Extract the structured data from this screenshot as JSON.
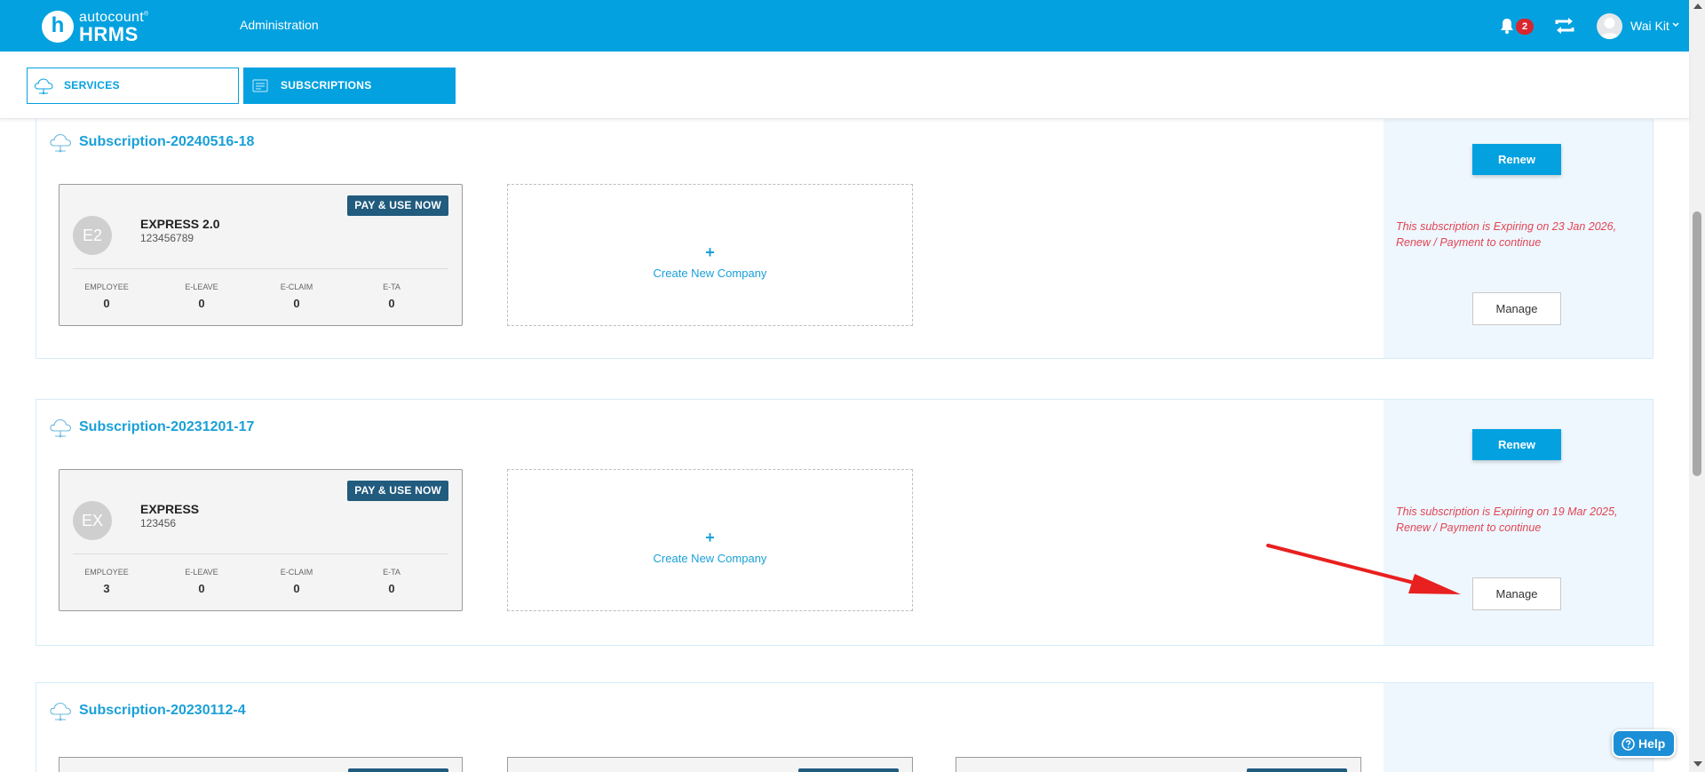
{
  "header": {
    "logo_small": "autocount",
    "logo_mark": "®",
    "logo_big": "HRMS",
    "logo_letter": "h",
    "nav_admin": "Administration",
    "notification_count": "2",
    "user_name": "Wai Kit",
    "bg_color": "#03a1e0"
  },
  "tabs": [
    {
      "label": "SERVICES",
      "icon": "cloud-icon",
      "active": false
    },
    {
      "label": "SUBSCRIPTIONS",
      "icon": "subscription-icon",
      "active": true
    }
  ],
  "subscriptions": [
    {
      "title": "Subscription-20240516-18",
      "company": {
        "badge": "PAY & USE NOW",
        "avatar": "E2",
        "name": "EXPRESS 2.0",
        "id": "123456789",
        "stats": [
          {
            "label": "EMPLOYEE",
            "value": "0"
          },
          {
            "label": "E-LEAVE",
            "value": "0"
          },
          {
            "label": "E-CLAIM",
            "value": "0"
          },
          {
            "label": "E-TA",
            "value": "0"
          }
        ]
      },
      "create_plus": "+",
      "create_label": "Create New Company",
      "renew_label": "Renew",
      "expiry_line1": "This subscription is Expiring on 23 Jan 2026,",
      "expiry_line2": "Renew / Payment to continue",
      "manage_label": "Manage"
    },
    {
      "title": "Subscription-20231201-17",
      "company": {
        "badge": "PAY & USE NOW",
        "avatar": "EX",
        "name": "EXPRESS",
        "id": "123456",
        "stats": [
          {
            "label": "EMPLOYEE",
            "value": "3"
          },
          {
            "label": "E-LEAVE",
            "value": "0"
          },
          {
            "label": "E-CLAIM",
            "value": "0"
          },
          {
            "label": "E-TA",
            "value": "0"
          }
        ]
      },
      "create_plus": "+",
      "create_label": "Create New Company",
      "renew_label": "Renew",
      "expiry_line1": "This subscription is Expiring on 19 Mar 2025,",
      "expiry_line2": "Renew / Payment to continue",
      "manage_label": "Manage"
    },
    {
      "title": "Subscription-20230112-4"
    }
  ],
  "help": {
    "label": "Help"
  },
  "colors": {
    "accent": "#03a1e0",
    "badge": "#215b7e",
    "expiry_text": "#e24454",
    "annotation_arrow": "#e8201f"
  }
}
